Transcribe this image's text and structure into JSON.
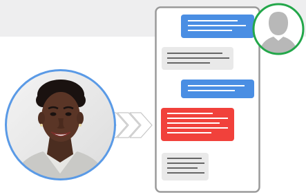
{
  "scene": {
    "user_photo": "smiling-woman-portrait",
    "contact_avatar": "generic-person-silhouette",
    "arrows_icon": "chevron-right-triple",
    "messages": [
      {
        "side": "right",
        "color": "#4a8ee3",
        "lines": 3
      },
      {
        "side": "left",
        "color": "#e9e9e9",
        "lines": 3
      },
      {
        "side": "right",
        "color": "#4a8ee3",
        "lines": 2
      },
      {
        "side": "left",
        "color": "#f1413b",
        "lines": 5
      },
      {
        "side": "left",
        "color": "#e9e9e9",
        "lines": 4
      }
    ],
    "colors": {
      "user_ring": "#5a9ae6",
      "contact_ring": "#23a74a",
      "phone_border": "#9a9a9a",
      "band": "#eeeeef"
    }
  }
}
